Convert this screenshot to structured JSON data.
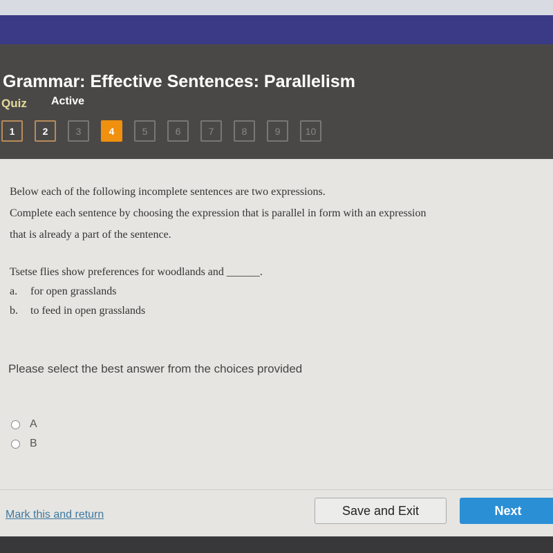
{
  "header": {
    "title": "Grammar: Effective Sentences: Parallelism",
    "type": "Quiz",
    "status": "Active"
  },
  "questions": [
    {
      "n": "1",
      "state": "done"
    },
    {
      "n": "2",
      "state": "done"
    },
    {
      "n": "3",
      "state": "todo"
    },
    {
      "n": "4",
      "state": "current"
    },
    {
      "n": "5",
      "state": "todo"
    },
    {
      "n": "6",
      "state": "todo"
    },
    {
      "n": "7",
      "state": "todo"
    },
    {
      "n": "8",
      "state": "todo"
    },
    {
      "n": "9",
      "state": "todo"
    },
    {
      "n": "10",
      "state": "todo"
    }
  ],
  "instructions": [
    "Below each of the following incomplete sentences are two expressions.",
    "Complete each sentence by choosing the expression that is parallel in form with an expression",
    "that is already a part of the sentence."
  ],
  "question": {
    "stem": "Tsetse flies show preferences for woodlands and ______.",
    "options": [
      {
        "letter": "a.",
        "text": "for open grasslands"
      },
      {
        "letter": "b.",
        "text": "to feed in open grasslands"
      }
    ]
  },
  "prompt": "Please select the best answer from the choices provided",
  "answers": [
    "A",
    "B"
  ],
  "footer": {
    "mark": "Mark this and return",
    "save": "Save and Exit",
    "next": "Next"
  },
  "colors": {
    "accent": "#f0900f",
    "next": "#2b8fd6",
    "band": "#3a3a86"
  }
}
